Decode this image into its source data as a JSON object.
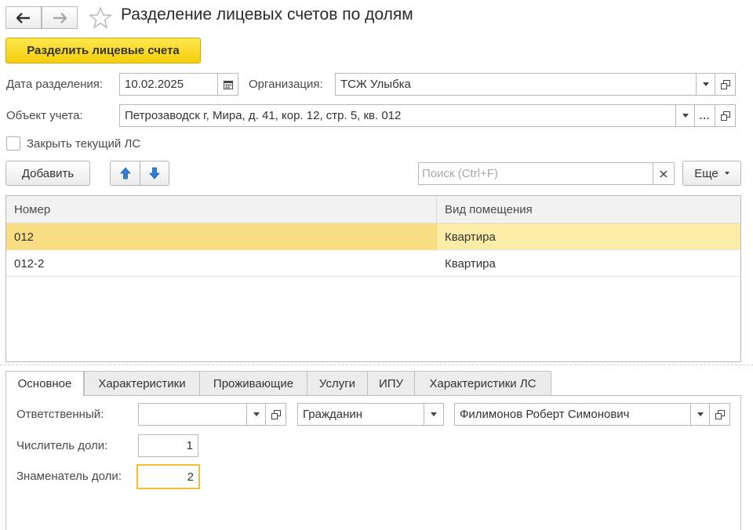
{
  "window": {
    "title": "Разделение лицевых счетов по долям"
  },
  "toolbar": {
    "main_action_label": "Разделить лицевые счета"
  },
  "form": {
    "date_label": "Дата разделения:",
    "date_value": "10.02.2025",
    "org_label": "Организация:",
    "org_value": "ТСЖ Улыбка",
    "object_label": "Объект учета:",
    "object_value": "Петрозаводск г, Мира, д. 41, кор. 12, стр. 5, кв. 012",
    "object_more": "...",
    "close_label": "Закрыть текущий ЛС",
    "close_checked": false
  },
  "table_toolbar": {
    "add_label": "Добавить",
    "search_placeholder": "Поиск (Ctrl+F)",
    "more_label": "Еще"
  },
  "table": {
    "columns": [
      "Номер",
      "Вид помещения"
    ],
    "rows": [
      {
        "number": "012",
        "type": "Квартира",
        "selected": true
      },
      {
        "number": "012-2",
        "type": "Квартира",
        "selected": false
      }
    ]
  },
  "tabs": [
    {
      "label": "Основное",
      "active": true
    },
    {
      "label": "Характеристики",
      "active": false
    },
    {
      "label": "Проживающие",
      "active": false
    },
    {
      "label": "Услуги",
      "active": false
    },
    {
      "label": "ИПУ",
      "active": false
    },
    {
      "label": "Характеристики ЛС",
      "active": false
    }
  ],
  "details": {
    "responsible_label": "Ответственный:",
    "responsible_value": "",
    "person_type": "Гражданин",
    "person_name": "Филимонов Роберт Симонович",
    "numerator_label": "Числитель доли:",
    "numerator_value": "1",
    "denominator_label": "Знаменатель доли:",
    "denominator_value": "2"
  },
  "colors": {
    "main_button": "#f5ce0a",
    "selected_row": "#fbeca8",
    "focus_border": "#f0c030",
    "arrow_blue": "#2f7fd6"
  }
}
